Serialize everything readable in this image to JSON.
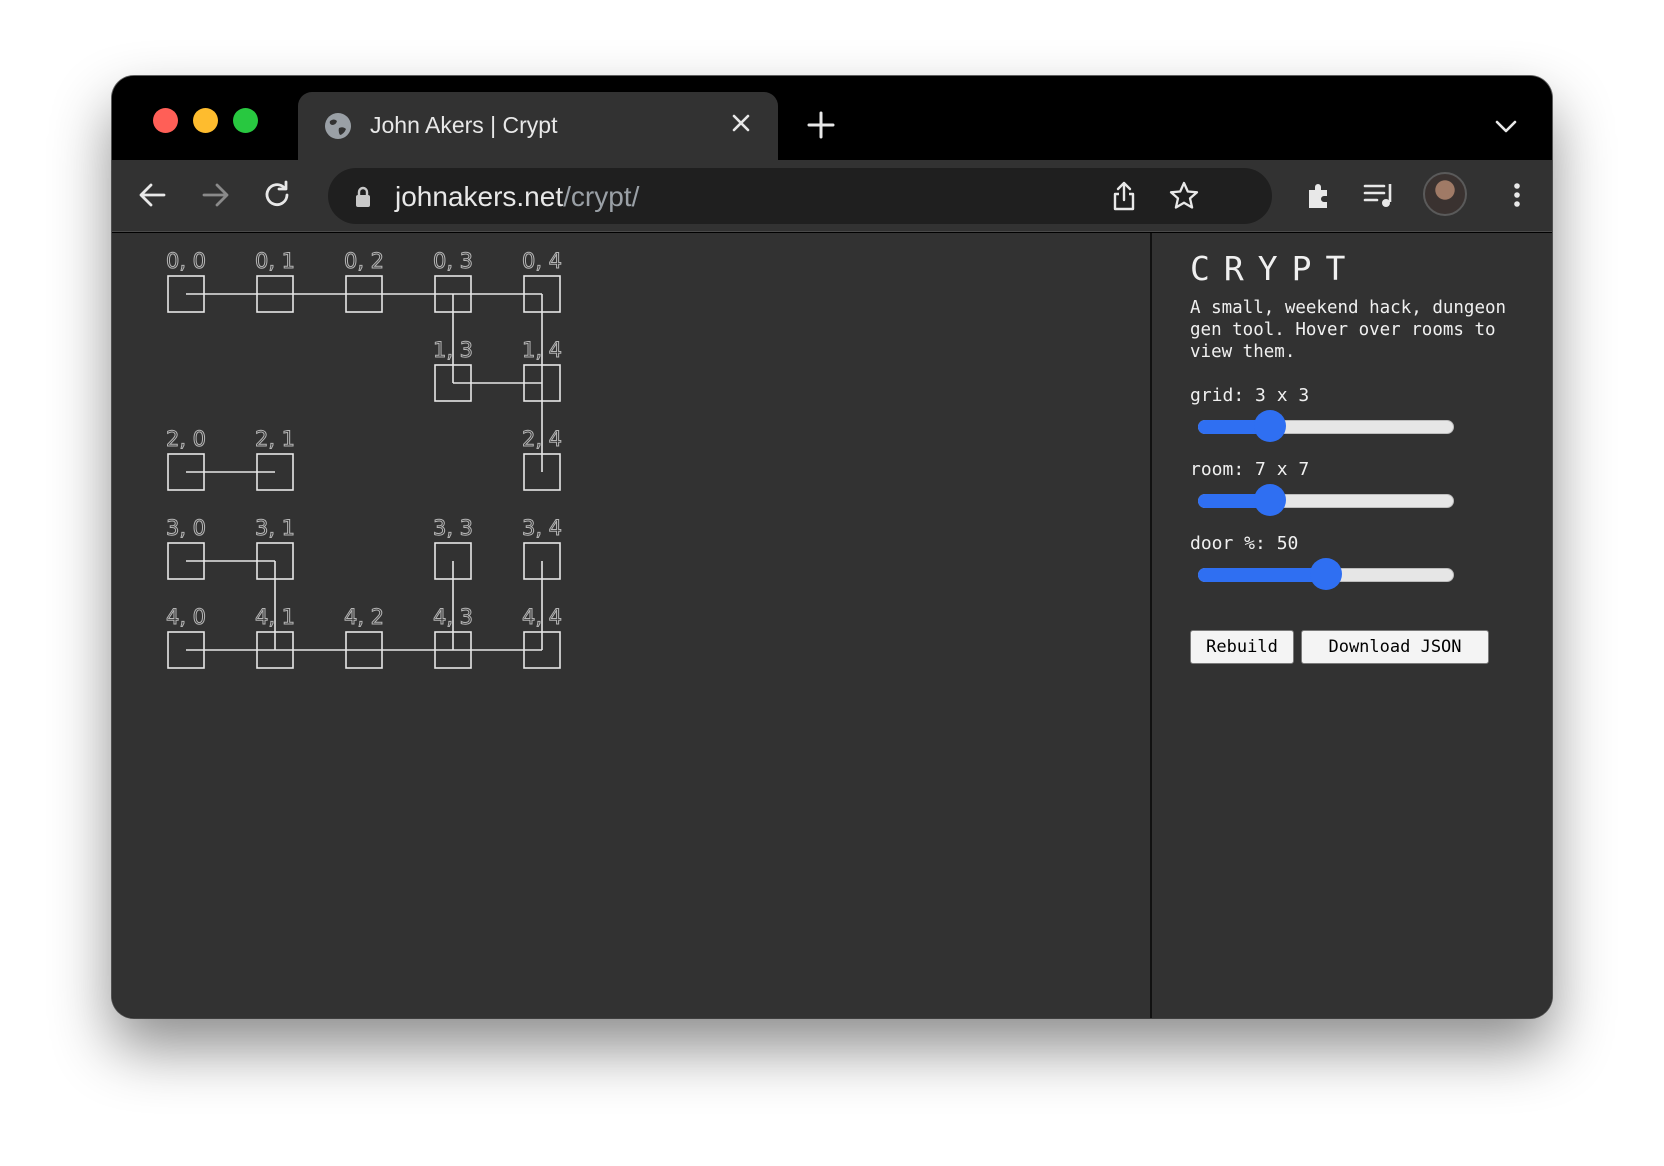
{
  "browser": {
    "tab_title": "John Akers | Crypt",
    "url_host": "johnakers.net",
    "url_path": "/crypt/"
  },
  "sidebar": {
    "title": "CRYPT",
    "description": "A small, weekend hack, dungeon gen tool. Hover over rooms to view them.",
    "controls": [
      {
        "label": "grid: 3 x 3",
        "value_fraction": 0.28
      },
      {
        "label": "room: 7 x 7",
        "value_fraction": 0.28
      },
      {
        "label": "door %: 50",
        "value_fraction": 0.5
      }
    ],
    "rebuild_label": "Rebuild",
    "download_label": "Download JSON"
  },
  "map": {
    "rooms": [
      {
        "label": "0, 0",
        "row": 0,
        "col": 0
      },
      {
        "label": "0, 1",
        "row": 0,
        "col": 1
      },
      {
        "label": "0, 2",
        "row": 0,
        "col": 2
      },
      {
        "label": "0, 3",
        "row": 0,
        "col": 3
      },
      {
        "label": "0, 4",
        "row": 0,
        "col": 4
      },
      {
        "label": "1, 3",
        "row": 1,
        "col": 3
      },
      {
        "label": "1, 4",
        "row": 1,
        "col": 4
      },
      {
        "label": "2, 0",
        "row": 2,
        "col": 0
      },
      {
        "label": "2, 1",
        "row": 2,
        "col": 1
      },
      {
        "label": "2, 4",
        "row": 2,
        "col": 4
      },
      {
        "label": "3, 0",
        "row": 3,
        "col": 0
      },
      {
        "label": "3, 1",
        "row": 3,
        "col": 1
      },
      {
        "label": "3, 3",
        "row": 3,
        "col": 3
      },
      {
        "label": "3, 4",
        "row": 3,
        "col": 4
      },
      {
        "label": "4, 0",
        "row": 4,
        "col": 0
      },
      {
        "label": "4, 1",
        "row": 4,
        "col": 1
      },
      {
        "label": "4, 2",
        "row": 4,
        "col": 2
      },
      {
        "label": "4, 3",
        "row": 4,
        "col": 3
      },
      {
        "label": "4, 4",
        "row": 4,
        "col": 4
      }
    ],
    "corridors": [
      {
        "from": [
          0,
          0
        ],
        "to": [
          0,
          4
        ]
      },
      {
        "from": [
          0,
          3
        ],
        "to": [
          1,
          3
        ]
      },
      {
        "from": [
          1,
          3
        ],
        "to": [
          1,
          4
        ]
      },
      {
        "from": [
          0,
          4
        ],
        "to": [
          2,
          4
        ]
      },
      {
        "from": [
          2,
          0
        ],
        "to": [
          2,
          1
        ]
      },
      {
        "from": [
          3,
          0
        ],
        "to": [
          3,
          1
        ]
      },
      {
        "from": [
          3,
          1
        ],
        "to": [
          4,
          1
        ]
      },
      {
        "from": [
          3,
          3
        ],
        "to": [
          4,
          3
        ]
      },
      {
        "from": [
          3,
          4
        ],
        "to": [
          4,
          4
        ]
      },
      {
        "from": [
          4,
          0
        ],
        "to": [
          4,
          4
        ]
      }
    ]
  }
}
